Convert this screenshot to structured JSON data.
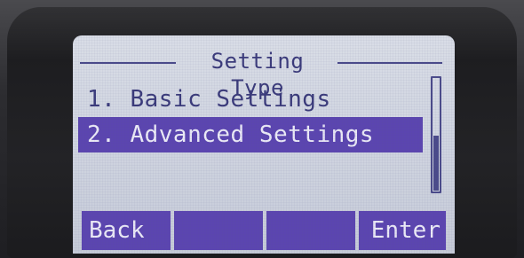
{
  "screen": {
    "title": "Setting Type"
  },
  "menu": {
    "items": [
      {
        "label": "1. Basic Settings",
        "selected": false
      },
      {
        "label": "2. Advanced Settings",
        "selected": true
      }
    ]
  },
  "scrollbar": {
    "position_fraction": 0.5
  },
  "softkeys": {
    "key1": "Back",
    "key2": "",
    "key3": "",
    "key4": "Enter"
  },
  "colors": {
    "highlight": "#5b45b0",
    "lcd_background": "#d2d6e2",
    "lcd_text": "#3a3a7a"
  }
}
